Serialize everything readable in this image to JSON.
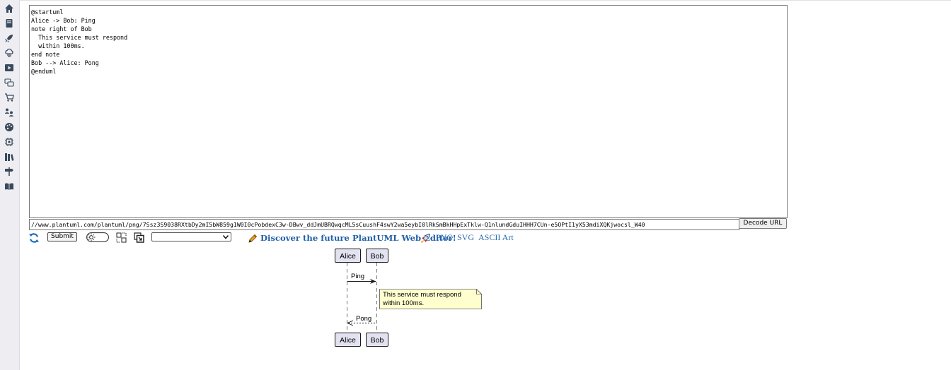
{
  "sidebar": {
    "items": [
      {
        "name": "home-icon"
      },
      {
        "name": "book-icon"
      },
      {
        "name": "rocket-icon"
      },
      {
        "name": "cloud-icon"
      },
      {
        "name": "play-icon"
      },
      {
        "name": "chat-icon"
      },
      {
        "name": "cart-icon"
      },
      {
        "name": "users-icon"
      },
      {
        "name": "palette-icon"
      },
      {
        "name": "chip-icon"
      },
      {
        "name": "library-icon"
      },
      {
        "name": "signpost-icon"
      },
      {
        "name": "open-book-icon"
      }
    ]
  },
  "editor": {
    "source": "@startuml\nAlice -> Bob: Ping\nnote right of Bob\n  This service must respond\n  within 100ms.\nend note\nBob --> Alice: Pong\n@enduml"
  },
  "url_bar": {
    "value": "//www.plantuml.com/plantuml/png/7Ssz3S9038RXtbDy2mI5bW859g1W0I0cPobdexC3w-DBwv_ddJmUBRQwqcML5sCuushF4swY2wa5eybI0lRkSmBkHHpExTklw-Q1nlundGduIHHH7CUn-e5OPtI1yX53mdiXQKjwocsl_W40",
    "decode_label": "Decode URL"
  },
  "toolbar": {
    "submit_label": "Submit",
    "select_value": "",
    "discover_label": "Discover the future PlantUML Web Editor!",
    "formats": [
      "PNG",
      "SVG",
      "ASCII Art"
    ]
  },
  "diagram": {
    "participants": [
      "Alice",
      "Bob"
    ],
    "messages": [
      {
        "from": "Alice",
        "to": "Bob",
        "label": "Ping",
        "style": "solid"
      },
      {
        "from": "Bob",
        "to": "Alice",
        "label": "Pong",
        "style": "dashed"
      }
    ],
    "note": {
      "position": "right of Bob",
      "lines": [
        "This service must respond",
        "within 100ms."
      ]
    }
  },
  "colors": {
    "link": "#1f5fa8",
    "participant_fill": "#e2e2f0",
    "note_fill": "#fefece",
    "sidebar_bg": "#eeeef2"
  }
}
